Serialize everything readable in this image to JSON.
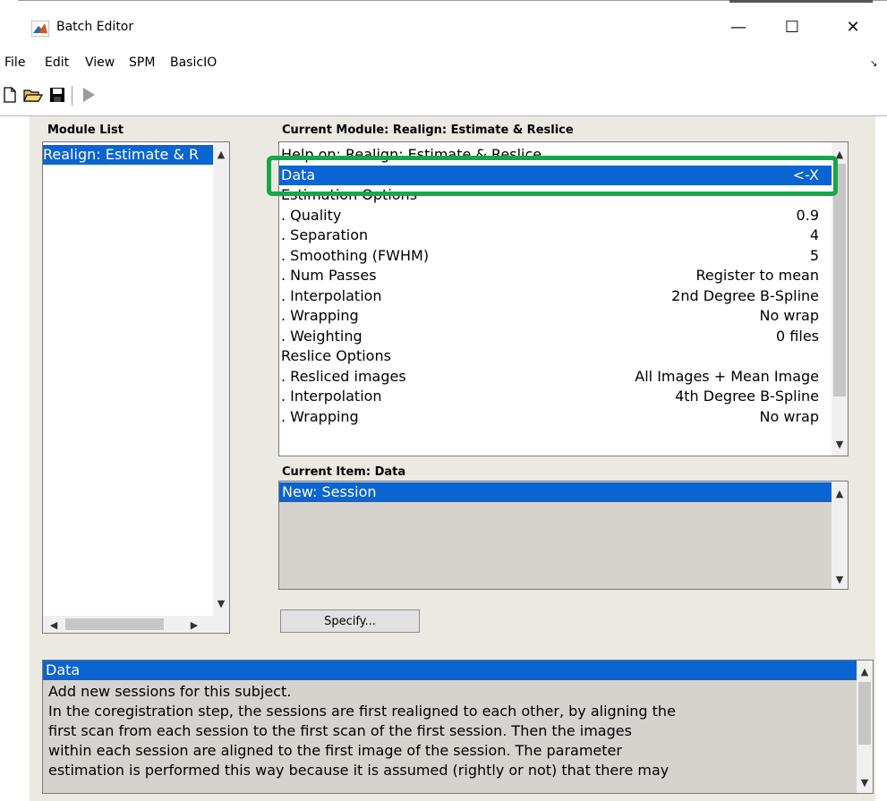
{
  "window": {
    "title": "Batch Editor",
    "controls": {
      "minimize": "—",
      "maximize": "☐",
      "close": "✕"
    }
  },
  "menubar": {
    "items": [
      "File",
      "Edit",
      "View",
      "SPM",
      "BasicIO"
    ],
    "overflow_glyph": "↘"
  },
  "toolbar": {
    "icons": [
      "new-file-icon",
      "open-folder-icon",
      "save-icon",
      "run-icon"
    ]
  },
  "module_list": {
    "header": "Module List",
    "items": [
      "Realign: Estimate & R"
    ],
    "selected_index": 0
  },
  "current_module": {
    "header": "Current Module: Realign: Estimate & Reslice",
    "rows": [
      {
        "label": "Help on: Realign: Estimate & Reslice",
        "value": ""
      },
      {
        "label": "Data",
        "value": "<-X"
      },
      {
        "label": "Estimation Options",
        "value": ""
      },
      {
        "label": ". Quality",
        "value": "0.9"
      },
      {
        "label": ". Separation",
        "value": "4"
      },
      {
        "label": ". Smoothing (FWHM)",
        "value": "5"
      },
      {
        "label": ". Num Passes",
        "value": "Register to mean"
      },
      {
        "label": ". Interpolation",
        "value": "2nd Degree B-Spline"
      },
      {
        "label": ". Wrapping",
        "value": "No wrap"
      },
      {
        "label": ". Weighting",
        "value": "0 files"
      },
      {
        "label": "Reslice Options",
        "value": ""
      },
      {
        "label": ". Resliced images",
        "value": "All Images + Mean Image"
      },
      {
        "label": ". Interpolation",
        "value": "4th Degree B-Spline"
      },
      {
        "label": ". Wrapping",
        "value": "No wrap"
      }
    ],
    "selected_index": 1
  },
  "current_item": {
    "header": "Current Item: Data",
    "items": [
      "New: Session"
    ]
  },
  "specify_button": "Specify...",
  "help": {
    "title": "Data",
    "lines": [
      "Add new sessions for this subject.",
      "In  the coregistration step, the sessions are first realigned to each other, by aligning the",
      "first  scan  from  each  session  to  the first scan of the first session.  Then the images",
      "within  each  session  are  aligned  to  the  first  image  of  the  session. The parameter",
      "estimation  is  performed  this way because it is assumed (rightly or not) that there may"
    ]
  },
  "colors": {
    "selection": "#0a64d2",
    "panel_bg": "#ece9e2",
    "highlight": "#14a84a"
  }
}
